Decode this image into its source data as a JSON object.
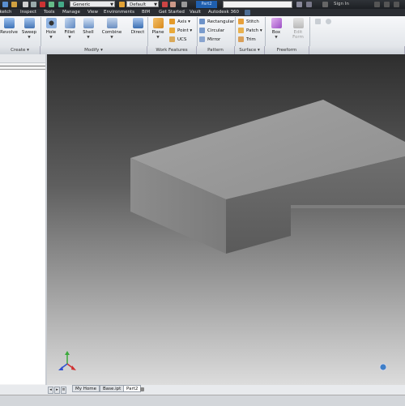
{
  "quick_access": {
    "material_combo": "Generic",
    "appearance_combo": "Default",
    "title_badge": "Part2",
    "sign_in": "Sign In"
  },
  "ribbon_tabs": [
    "Sketch",
    "Inspect",
    "Tools",
    "Manage",
    "View",
    "Environments",
    "BIM",
    "Get Started",
    "Vault",
    "Autodesk 360"
  ],
  "ribbon": {
    "create": {
      "revolve": "Revolve",
      "sweep": "Sweep"
    },
    "modify": {
      "hole": "Hole",
      "fillet": "Fillet",
      "shell": "Shell",
      "combine": "Combine",
      "direct": "Direct"
    },
    "work_features": {
      "plane": "Plane",
      "axis": "Axis",
      "point": "Point",
      "ucs": "UCS"
    },
    "pattern": {
      "rectangular": "Rectangular",
      "circular": "Circular",
      "mirror": "Mirror"
    },
    "surface": {
      "stitch": "Stitch",
      "patch": "Patch",
      "trim": "Trim"
    },
    "freeform": {
      "box": "Box",
      "edit_form_1": "Edit",
      "edit_form_2": "Form"
    }
  },
  "panels": {
    "create": "Create",
    "modify": "Modify",
    "work_features": "Work Features",
    "pattern": "Pattern",
    "surface": "Surface",
    "freeform": "Freeform"
  },
  "doc_tabs": [
    "My Home",
    "Base.ipt",
    "Part2"
  ],
  "colors": {
    "ribbon_bg": "#e6e9ed",
    "title_bar": "#23272c",
    "accent": "#1f5fae"
  }
}
